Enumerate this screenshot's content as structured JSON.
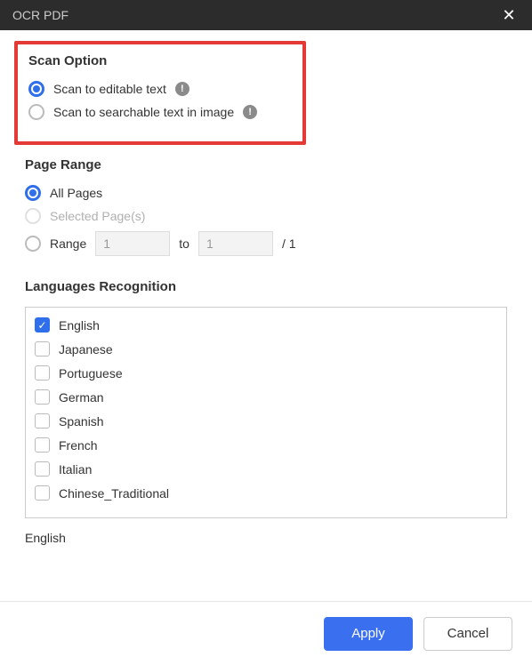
{
  "title": "OCR PDF",
  "scan": {
    "heading": "Scan Option",
    "opt1": "Scan to editable text",
    "opt2": "Scan to searchable text in image"
  },
  "range": {
    "heading": "Page Range",
    "all": "All Pages",
    "selected": "Selected Page(s)",
    "rangeLabel": "Range",
    "from": "1",
    "to": "1",
    "toLabel": "to",
    "total": "/ 1"
  },
  "langHeading": "Languages Recognition",
  "langs": [
    "English",
    "Japanese",
    "Portuguese",
    "German",
    "Spanish",
    "French",
    "Italian",
    "Chinese_Traditional"
  ],
  "selectedLang": "English",
  "buttons": {
    "apply": "Apply",
    "cancel": "Cancel"
  },
  "infoGlyph": "!",
  "checkGlyph": "✓"
}
